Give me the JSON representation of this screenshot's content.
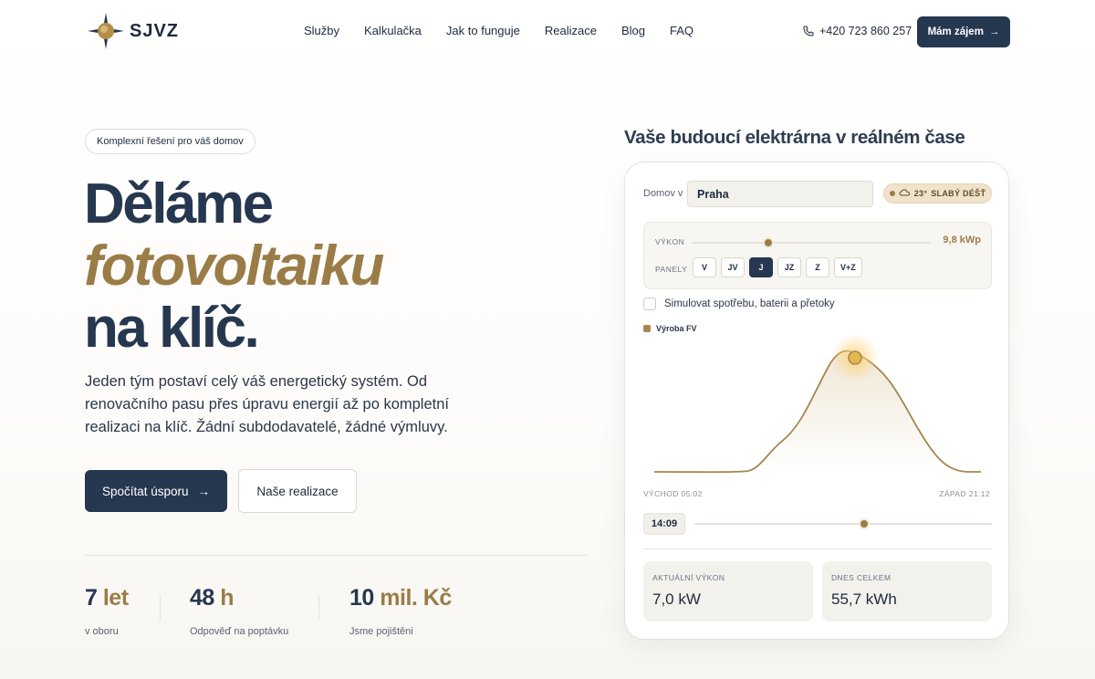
{
  "nav": {
    "logo_text": "SJVZ",
    "items": [
      "Služby",
      "Kalkulačka",
      "Jak to funguje",
      "Realizace",
      "Blog",
      "FAQ"
    ],
    "phone": "+420 723 860 257",
    "cta_label": "Mám zájem"
  },
  "hero": {
    "badge": "Komplexní řešení pro váš domov",
    "title_line1": "Děláme",
    "title_accent": "fotovoltaiku",
    "title_line3": "na klíč.",
    "lead": "Jeden tým postaví celý váš energetický systém. Od renovačního pasu přes úpravu energií až po kompletní realizaci na klíč. Žádní subdodavatelé, žádné výmluvy.",
    "primary_cta": "Spočítat úsporu",
    "secondary_cta": "Naše realizace",
    "stats": [
      {
        "value": "7",
        "unit": "let",
        "label": "v oboru"
      },
      {
        "value": "48",
        "unit": "h",
        "label": "Odpověď na poptávku"
      },
      {
        "value": "10",
        "unit": "mil. Kč",
        "label": "Jsme pojištěni"
      }
    ]
  },
  "simulator": {
    "heading": "Vaše budoucí elektrárna v reálném čase",
    "location_label": "Domov v",
    "location_value": "Praha",
    "weather_temp": "23°",
    "weather_text": "SLABÝ DÉŠŤ",
    "power_label": "VÝKON",
    "power_value": "9,8 kWp",
    "power_fraction": 0.32,
    "panels_label": "PANELY",
    "panel_options": [
      "V",
      "JV",
      "J",
      "JZ",
      "Z",
      "V+Z"
    ],
    "panel_selected": "J",
    "simulate_label": "Simulovat spotřebu, baterii a přetoky",
    "simulate_checked": false,
    "legend_label": "Výroba FV",
    "sunrise_label": "VÝCHOD 05:02",
    "sunset_label": "ZÁPAD 21:12",
    "time_value": "14:09",
    "time_fraction": 0.57,
    "current_label": "AKTUÁLNÍ VÝKON",
    "current_value": "7,0 kW",
    "total_label": "DNES CELKEM",
    "total_value": "55,7 kWh"
  },
  "colors": {
    "navy": "#263750",
    "gold": "#9a7c47"
  }
}
